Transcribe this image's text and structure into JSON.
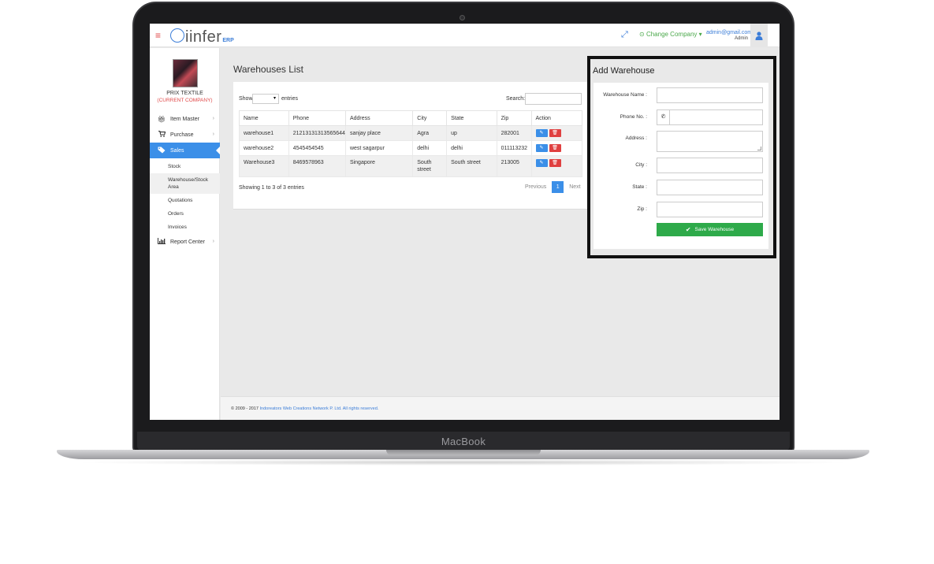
{
  "device": {
    "brand": "MacBook"
  },
  "topbar": {
    "logo_text": "iinfer",
    "logo_suffix": "ERP",
    "change_company": "Change Company",
    "user_email": "admin@gmail.com",
    "user_role": "Admin"
  },
  "sidebar": {
    "company_name": "PRIX TEXTILE",
    "company_current": "(CURRENT COMPANY)",
    "items": [
      {
        "label": "Item Master",
        "icon": "gift-icon"
      },
      {
        "label": "Purchase",
        "icon": "cart-icon"
      },
      {
        "label": "Sales",
        "icon": "tags-icon",
        "active": true
      },
      {
        "label": "Report Center",
        "icon": "bar-chart-icon"
      }
    ],
    "sales_sub": [
      {
        "label": "Stock"
      },
      {
        "label": "Warehouse/Stock Area",
        "active": true
      },
      {
        "label": "Quotations"
      },
      {
        "label": "Orders"
      },
      {
        "label": "Invoices"
      }
    ]
  },
  "main": {
    "title": "Warehouses List",
    "show_label": "Show",
    "entries_label": "entries",
    "search_label": "Search:",
    "columns": [
      "Name",
      "Phone",
      "Address",
      "City",
      "State",
      "Zip",
      "Action"
    ],
    "rows": [
      {
        "name": "warehouse1",
        "phone": "21213131313565644",
        "address": "sanjay place",
        "city": "Agra",
        "state": "up",
        "zip": "282001"
      },
      {
        "name": "warehouse2",
        "phone": "4545454545",
        "address": "west sagarpur",
        "city": "delhi",
        "state": "delhi",
        "zip": "011113232"
      },
      {
        "name": "Warehouse3",
        "phone": "8469578963",
        "address": "Singapore",
        "city": "South street",
        "state": "South street",
        "zip": "213005"
      }
    ],
    "showing_text": "Showing 1 to 3 of 3 entries",
    "pager": {
      "previous": "Previous",
      "current": "1",
      "next": "Next"
    }
  },
  "add_form": {
    "title": "Add Warehouse",
    "labels": {
      "name": "Warehouse Name :",
      "phone": "Phone No. :",
      "address": "Address :",
      "city": "City :",
      "state": "State :",
      "zip": "Zip :"
    },
    "save_label": "Save Warehouse"
  },
  "footer": {
    "prefix": "© 2009 - 2017",
    "company": "Indoreators Web Creations Network P. Ltd. All rights reserved."
  },
  "colors": {
    "accent": "#3b8fe8",
    "danger": "#e04040",
    "success": "#2eaa4a",
    "highlight_border": "#111111"
  }
}
